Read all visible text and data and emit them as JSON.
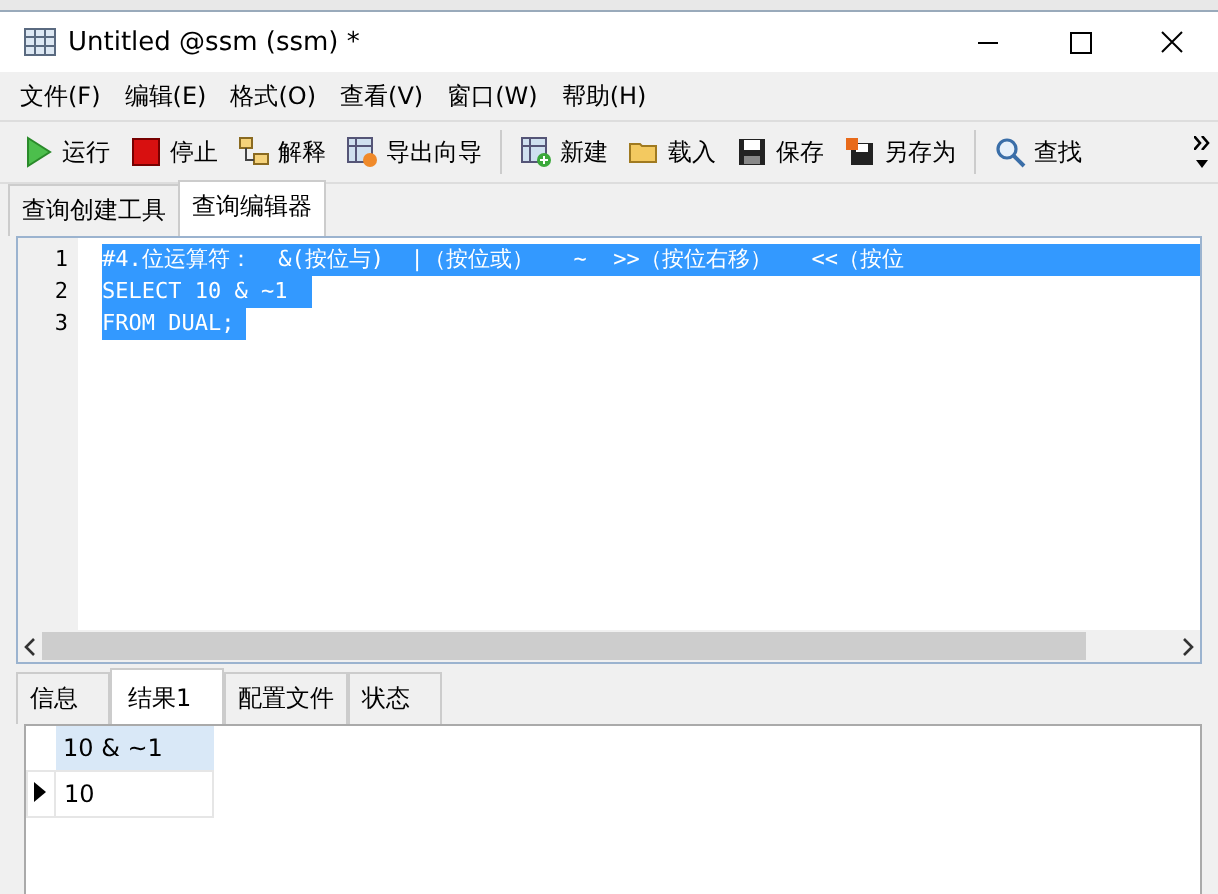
{
  "window": {
    "title": "Untitled @ssm (ssm) *"
  },
  "menu": [
    "文件(F)",
    "编辑(E)",
    "格式(O)",
    "查看(V)",
    "窗口(W)",
    "帮助(H)"
  ],
  "toolbar": [
    {
      "label": "运行",
      "separator_before": false
    },
    {
      "label": "停止",
      "separator_before": false
    },
    {
      "label": "解释",
      "separator_before": false
    },
    {
      "label": "导出向导",
      "separator_before": false
    },
    {
      "label": "新建",
      "separator_before": true
    },
    {
      "label": "载入",
      "separator_before": false
    },
    {
      "label": "保存",
      "separator_before": false
    },
    {
      "label": "另存为",
      "separator_before": false
    },
    {
      "label": "查找",
      "separator_before": true
    }
  ],
  "tabs": [
    {
      "label": "查询创建工具",
      "selected": false
    },
    {
      "label": "查询编辑器",
      "selected": true
    }
  ],
  "editor": {
    "lines": [
      {
        "number": "1",
        "text": "#4.位运算符：  &(按位与)  |（按位或）   ~  >>（按位右移）   <<（按位",
        "selected": true
      },
      {
        "number": "2",
        "text": "SELECT 10 & ~1 ",
        "selected": true
      },
      {
        "number": "3",
        "text": "FROM DUAL;",
        "selected": true
      }
    ]
  },
  "result_tabs": [
    {
      "label": "信息",
      "selected": false
    },
    {
      "label": "结果1",
      "selected": true
    },
    {
      "label": "配置文件",
      "selected": false
    },
    {
      "label": "状态",
      "selected": false
    }
  ],
  "result_grid": {
    "columns": [
      "10 & ~1"
    ],
    "rows": [
      {
        "cells": [
          "10"
        ],
        "current": true
      }
    ]
  }
}
